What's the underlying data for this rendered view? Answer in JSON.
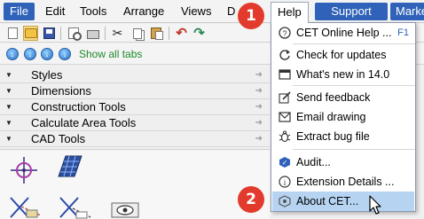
{
  "menubar": {
    "items": [
      "File",
      "Edit",
      "Tools",
      "Arrange",
      "Views",
      "D"
    ],
    "help": "Help",
    "support": "Support",
    "market": "Marke"
  },
  "toolbar": {
    "icons": [
      "new-icon",
      "open-icon",
      "save-icon",
      "print-preview-icon",
      "print-icon",
      "cut-icon",
      "copy-icon",
      "paste-icon",
      "undo-icon",
      "redo-icon"
    ]
  },
  "tabs_bar": {
    "show_all": "Show all tabs"
  },
  "accordion": {
    "items": [
      "Styles",
      "Dimensions",
      "Construction Tools",
      "Calculate Area Tools",
      "CAD Tools"
    ]
  },
  "help_menu": {
    "items": [
      {
        "label": "CET Online Help ...",
        "shortcut": "F1"
      },
      {
        "label": "Check for updates"
      },
      {
        "label": "What's new in 14.0"
      },
      {
        "label": "Send feedback"
      },
      {
        "label": "Email drawing"
      },
      {
        "label": "Extract bug file"
      },
      {
        "label": "Audit..."
      },
      {
        "label": "Extension Details ..."
      },
      {
        "label": "About CET..."
      }
    ]
  },
  "badges": [
    "1",
    "2"
  ],
  "colors": {
    "accent": "#2f62b8",
    "highlight": "#b6d4f2",
    "badge": "#e23a2c",
    "show_all": "#1d8a2a"
  }
}
